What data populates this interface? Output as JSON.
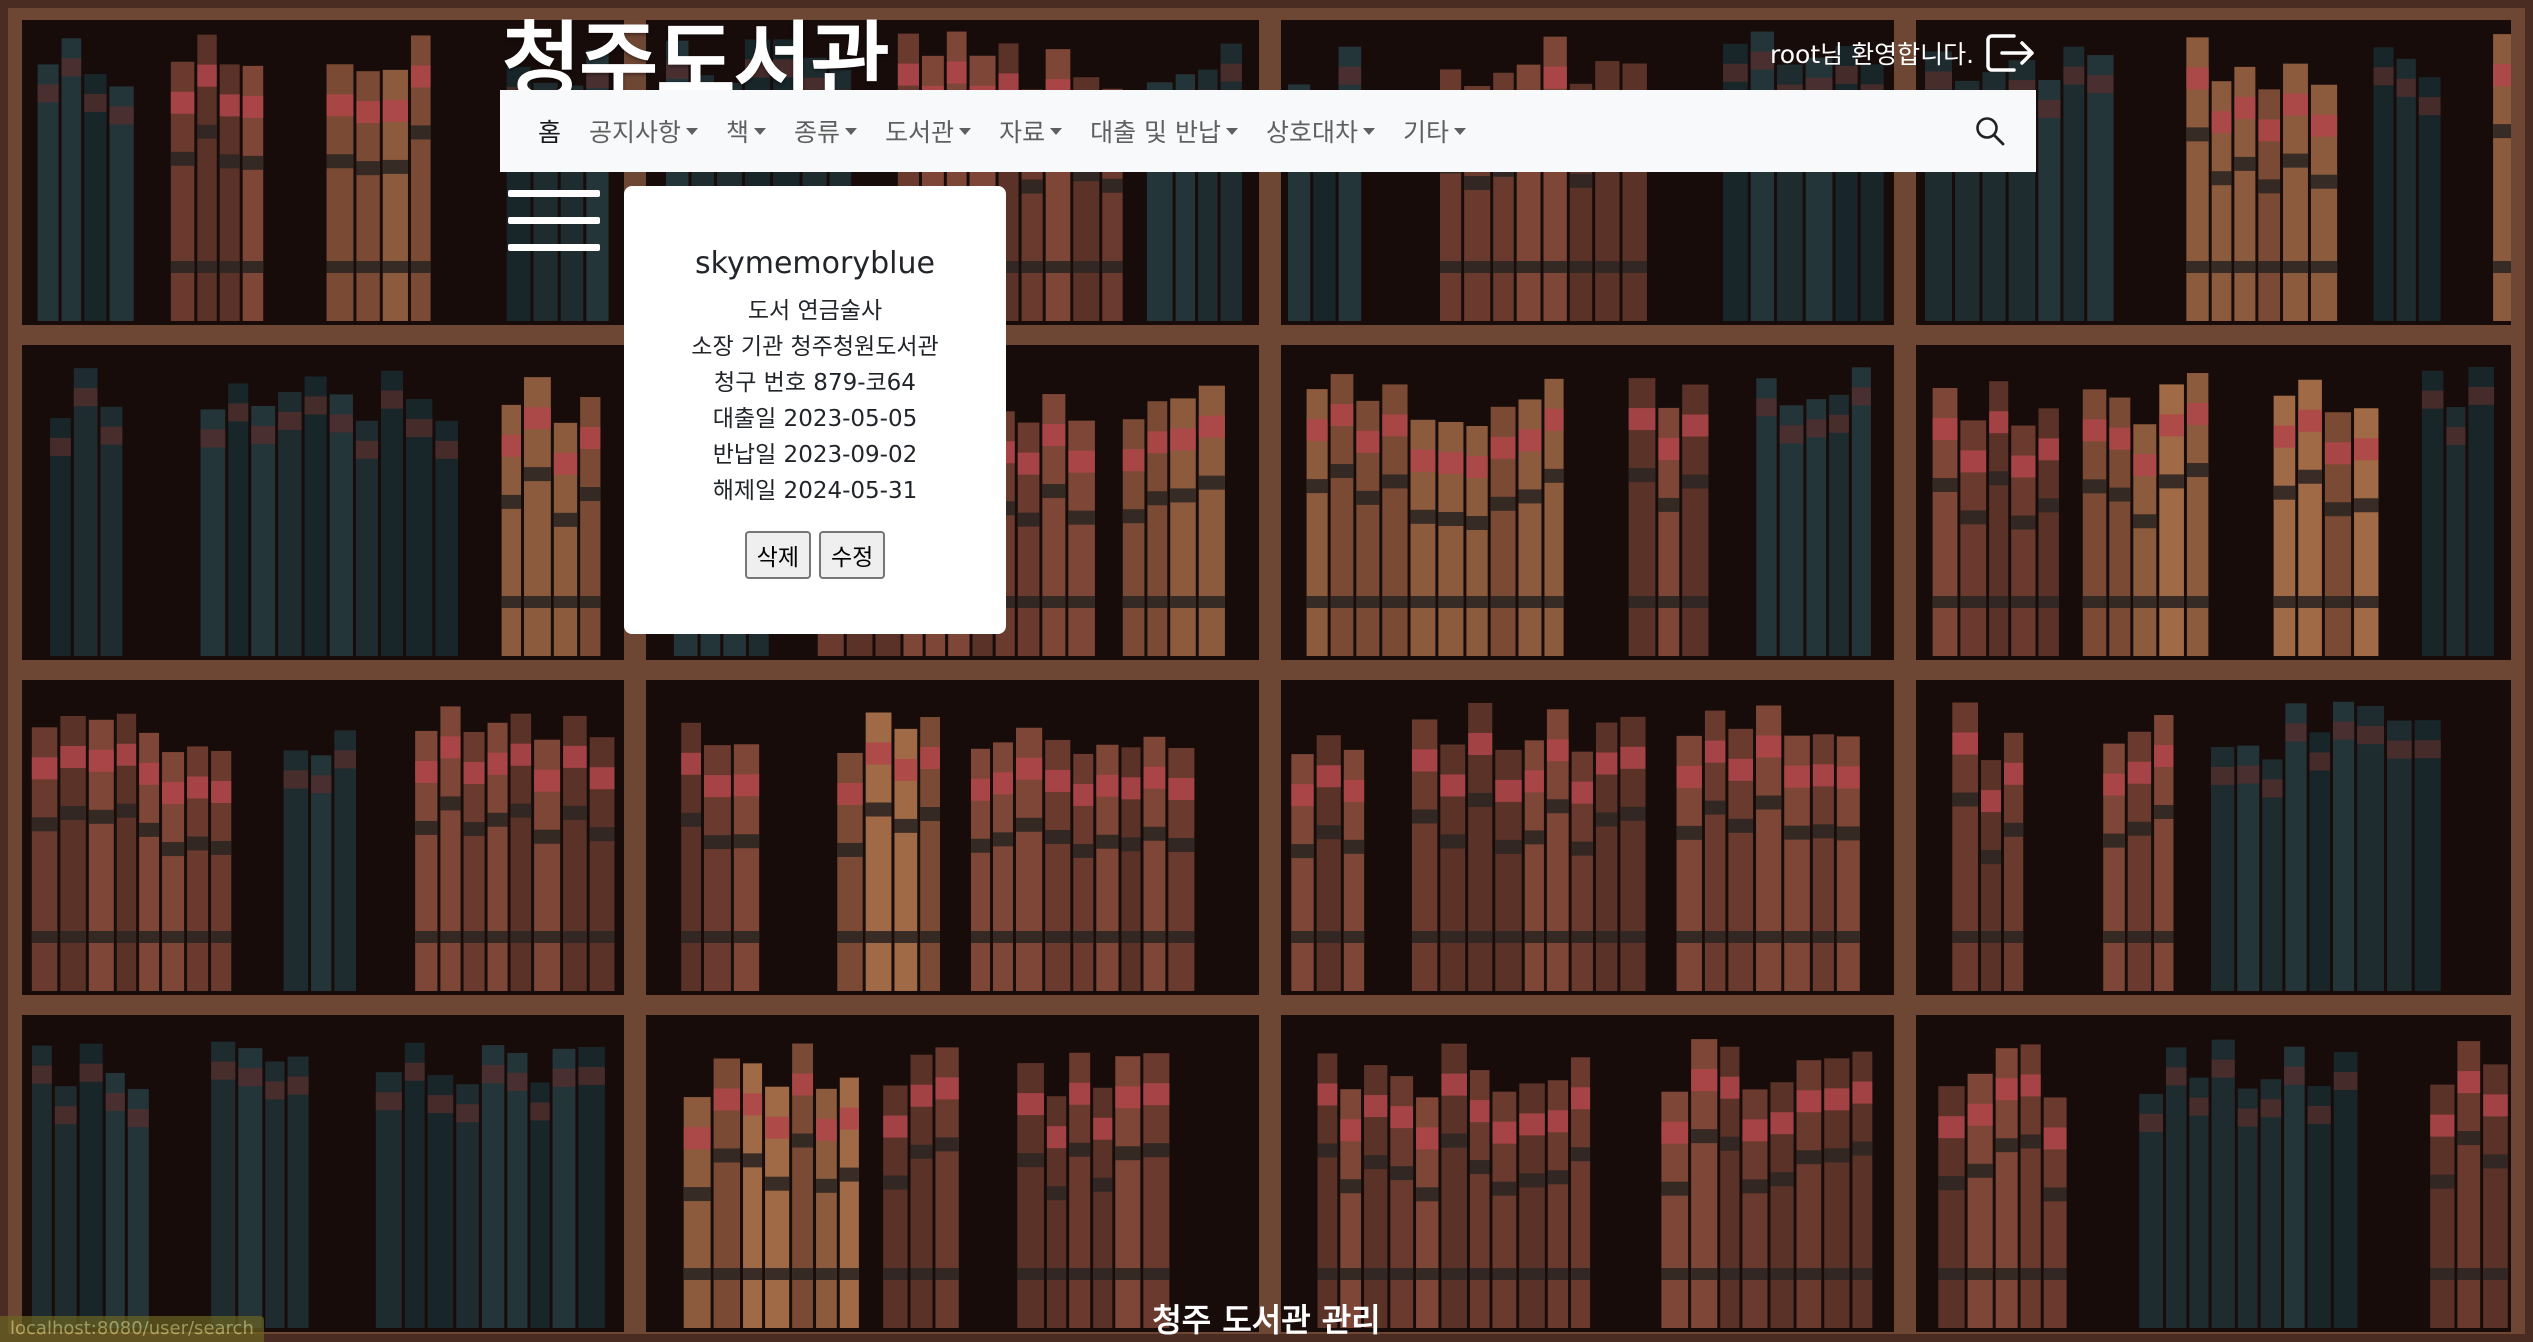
{
  "header": {
    "site_title": "청주도서관",
    "welcome_text": "root님 환영합니다.",
    "logout_icon": "logout-icon"
  },
  "nav": {
    "items": [
      {
        "label": "홈",
        "dropdown": false
      },
      {
        "label": "공지사항",
        "dropdown": true
      },
      {
        "label": "책",
        "dropdown": true
      },
      {
        "label": "종류",
        "dropdown": true
      },
      {
        "label": "도서관",
        "dropdown": true
      },
      {
        "label": "자료",
        "dropdown": true
      },
      {
        "label": "대출 및 반납",
        "dropdown": true
      },
      {
        "label": "상호대차",
        "dropdown": true
      },
      {
        "label": "기타",
        "dropdown": true
      }
    ],
    "search_icon": "search-icon",
    "background": "#f8f9fa"
  },
  "sidebar_toggle_icon": "hamburger-menu-icon",
  "loan_card": {
    "username": "skymemoryblue",
    "book": "도서 연금술사",
    "holding_library": "소장 기관 청주청원도서관",
    "call_number": "청구 번호 879-코64",
    "loan_date": "대출일 2023-05-05",
    "return_date": "반납일 2023-09-02",
    "release_date": "해제일 2024-05-31",
    "delete_label": "삭제",
    "edit_label": "수정"
  },
  "footer": {
    "label": "청주 도서관 관리",
    "status_url": "localhost:8080/user/search"
  }
}
